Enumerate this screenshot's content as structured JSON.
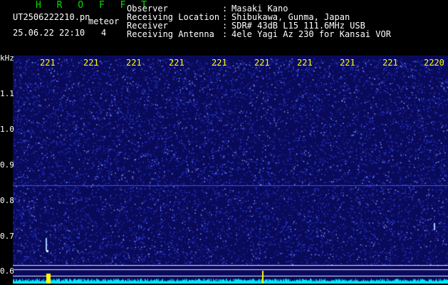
{
  "header": {
    "app_title": "H R O F F T",
    "file_name": "UT2506222210.pn",
    "tag": "meteor",
    "date_time": "25.06.22 22:10",
    "count": "4",
    "fields": [
      {
        "label": "Observer",
        "value": "Masaki Kano"
      },
      {
        "label": "Receiving Location",
        "value": "Shibukawa, Gunma, Japan"
      },
      {
        "label": "Receiver",
        "value": "SDR# 43dB L15 111.6MHz USB"
      },
      {
        "label": "Receiving Antenna",
        "value": "4ele Yagi Az 230 for Kansai VOR"
      }
    ]
  },
  "plot": {
    "y_unit": "kHz",
    "x_ticks": [
      "221",
      "221",
      "221",
      "221",
      "221",
      "221",
      "221",
      "221",
      "221",
      "2220"
    ],
    "y_ticks": [
      "1.1",
      "1.0",
      "0.9",
      "0.8",
      "0.7",
      "0.6"
    ],
    "colors": {
      "background": "#0a0a5a",
      "noise": "#3a4cff",
      "baseline": "#00e5ff",
      "tick_text": "#ffff00",
      "signal": "#ffff00"
    }
  }
}
